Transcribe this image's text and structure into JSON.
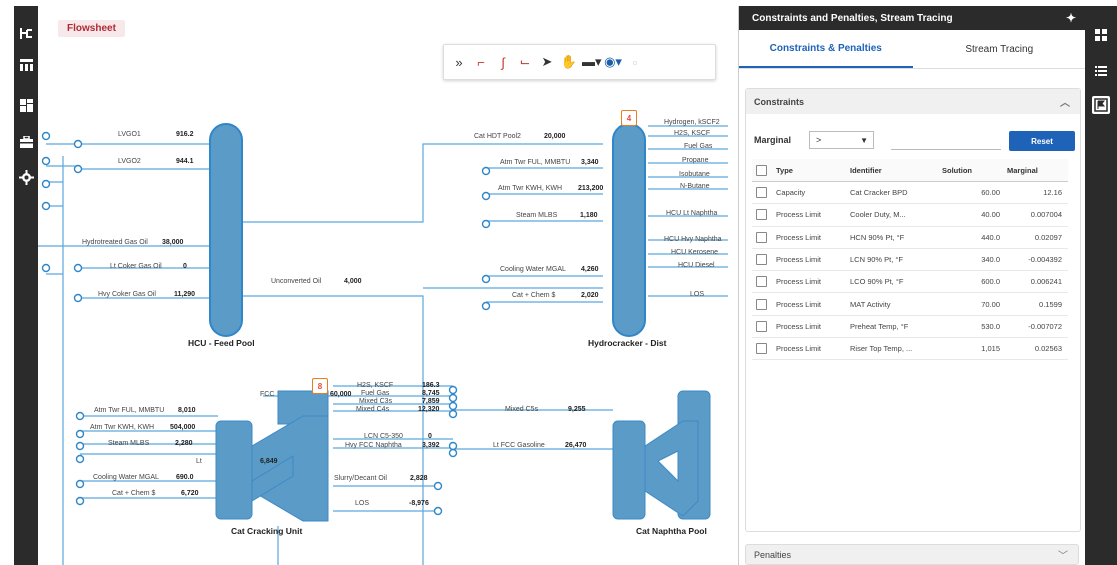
{
  "left_toolbar": {
    "icons": [
      "flow-tree-icon",
      "table-icon",
      "dashboard-icon",
      "toolbox-icon",
      "gear-icon"
    ]
  },
  "right_toolbar": {
    "icons": [
      "grid-icon",
      "list-icon",
      "flag-panel-icon"
    ]
  },
  "canvas": {
    "tab_label": "Flowsheet",
    "toolbar_icons": [
      "expand-icon",
      "connector-tool-icon",
      "curve-tool-icon",
      "link-tool-icon",
      "pointer-icon",
      "pan-hand-icon",
      "layout-icon",
      "view-eye-icon",
      "disabled-icon"
    ]
  },
  "flowsheet": {
    "hcu_feed": {
      "name": "HCU - Feed Pool",
      "inputs": [
        {
          "label": "LVGO1",
          "value": "916.2"
        },
        {
          "label": "LVGO2",
          "value": "944.1"
        },
        {
          "label": "Hydrotreated Gas Oil",
          "value": "38,000"
        },
        {
          "label": "Lt Coker Gas Oil",
          "value": "0"
        },
        {
          "label": "Hvy Coker Gas Oil",
          "value": "11,290"
        }
      ],
      "unconverted_label": "Unconverted Oil",
      "unconverted_value": "4,000"
    },
    "hydrocracker": {
      "name": "Hydrocracker - Dist",
      "badge": "4",
      "inputs": [
        {
          "label": "Cat HDT Pool2",
          "value": "20,000"
        },
        {
          "label": "Atm Twr FUL, MMBTU",
          "value": "3,340"
        },
        {
          "label": "Atm Twr KWH, KWH",
          "value": "213,200"
        },
        {
          "label": "Steam MLBS",
          "value": "1,180"
        },
        {
          "label": "Cooling Water MGAL",
          "value": "4,260"
        },
        {
          "label": "Cat + Chem $",
          "value": "2,020"
        }
      ],
      "outputs": [
        "Hydrogen, kSCF2",
        "H2S, KSCF",
        "Fuel Gas",
        "Propane",
        "Isobutane",
        "N-Butane",
        "HCU Lt Naphtha",
        "HCU Hvy Naphtha",
        "HCU Kerosene",
        "HCU Diesel",
        "LOS"
      ]
    },
    "cat_cracking": {
      "name": "Cat Cracking Unit",
      "badge": "8",
      "fcc_label": "FCC",
      "fcc_value": "60,000",
      "lt_label": "Lt",
      "partial_value": "6,849",
      "inputs": [
        {
          "label": "Atm Twr FUL, MMBTU",
          "value": "8,010"
        },
        {
          "label": "Atm Twr KWH, KWH",
          "value": "504,000"
        },
        {
          "label": "Steam MLBS",
          "value": "2,280"
        },
        {
          "label": "Cooling Water MGAL",
          "value": "690.0"
        },
        {
          "label": "Cat + Chem $",
          "value": "6,720"
        }
      ],
      "outputs": [
        {
          "label": "H2S, KSCF",
          "value": "186.3"
        },
        {
          "label": "Fuel Gas",
          "value": "8,745"
        },
        {
          "label": "Mixed C3s",
          "value": "7,859"
        },
        {
          "label": "Mixed C4s",
          "value": "12,320"
        },
        {
          "label": "LCN C5-350",
          "value": "0"
        },
        {
          "label": "Hvy FCC Naphtha",
          "value": "3,392"
        },
        {
          "label": "Slurry/Decant Oil",
          "value": "2,828"
        },
        {
          "label": "LOS",
          "value": "-8,976"
        }
      ]
    },
    "cat_naphtha": {
      "name": "Cat Naphtha Pool",
      "inputs": [
        {
          "label": "Mixed C5s",
          "value": "9,255"
        },
        {
          "label": "Lt FCC Gasoline",
          "value": "26,470"
        }
      ]
    }
  },
  "panel": {
    "title": "Constraints and Penalties, Stream Tracing",
    "tabs": [
      "Constraints & Penalties",
      "Stream Tracing"
    ],
    "constraints_header": "Constraints",
    "marginal_label": "Marginal",
    "marginal_operator": ">",
    "reset_label": "Reset",
    "columns": [
      "Type",
      "Identifier",
      "Solution",
      "Marginal"
    ],
    "rows": [
      {
        "type": "Capacity",
        "identifier": "Cat Cracker BPD",
        "solution": "60.00",
        "marginal": "12.16"
      },
      {
        "type": "Process Limit",
        "identifier": "Cooler Duty, M...",
        "solution": "40.00",
        "marginal": "0.007004"
      },
      {
        "type": "Process Limit",
        "identifier": "HCN 90% Pt, °F",
        "solution": "440.0",
        "marginal": "0.02097"
      },
      {
        "type": "Process Limit",
        "identifier": "LCN 90% Pt, °F",
        "solution": "340.0",
        "marginal": "-0.004392"
      },
      {
        "type": "Process Limit",
        "identifier": "LCO 90% Pt, °F",
        "solution": "600.0",
        "marginal": "0.006241"
      },
      {
        "type": "Process Limit",
        "identifier": "MAT Activity",
        "solution": "70.00",
        "marginal": "0.1599"
      },
      {
        "type": "Process Limit",
        "identifier": "Preheat Temp, °F",
        "solution": "530.0",
        "marginal": "-0.007072"
      },
      {
        "type": "Process Limit",
        "identifier": "Riser Top Temp, ...",
        "solution": "1,015",
        "marginal": "0.02563"
      }
    ],
    "penalties_header": "Penalties"
  },
  "colors": {
    "accent": "#1e63b8",
    "unit_fill": "#5b9bc8",
    "stream": "#5aa7dd",
    "badge": "#e74c3c"
  }
}
